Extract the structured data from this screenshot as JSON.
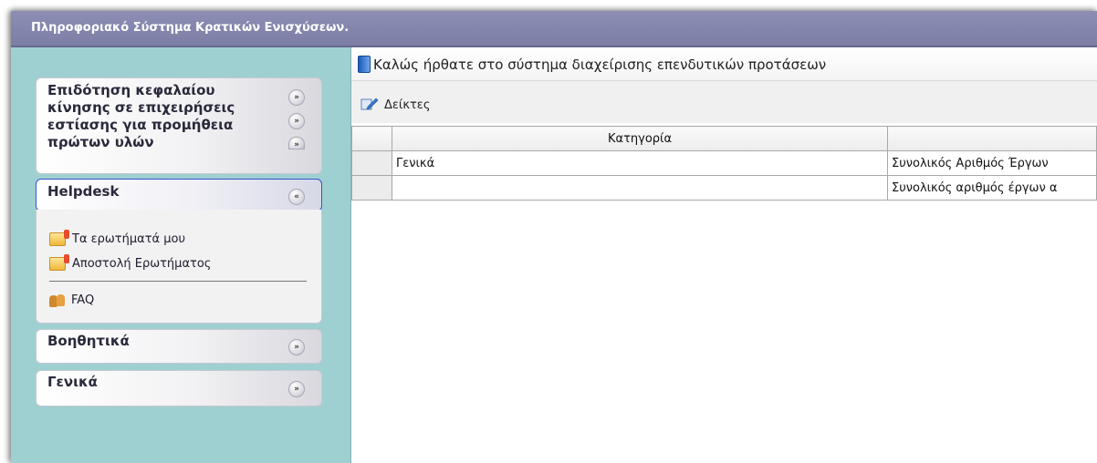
{
  "app": {
    "title": "Πληροφοριακό Σύστημα Κρατικών Ενισχύσεων."
  },
  "sidebar": {
    "panels": [
      {
        "title_lines": [
          "Επιδότηση κεφαλαίου",
          "κίνησης σε επιχειρήσεις",
          "εστίασης για προμήθεια",
          "πρώτων υλών"
        ],
        "expanded": false
      },
      {
        "title": "Helpdesk",
        "expanded": true,
        "links": [
          {
            "label": "Τα ερωτήματά μου",
            "icon": "folder-alert-icon"
          },
          {
            "label": "Αποστολή Ερωτήματος",
            "icon": "folder-alert-icon"
          },
          {
            "label": "FAQ",
            "icon": "users-icon"
          }
        ]
      },
      {
        "title": "Βοηθητικά",
        "expanded": false
      },
      {
        "title": "Γενικά",
        "expanded": false
      }
    ]
  },
  "main": {
    "welcome": "Καλώς ήρθατε στο σύστημα διαχείρισης επενδυτικών προτάσεων",
    "toolbar_label": "Δείκτες",
    "table": {
      "headers": [
        "",
        "Κατηγορία",
        ""
      ],
      "rows": [
        [
          "",
          "Γενικά",
          "Συνολικός Αριθμός Έργων"
        ],
        [
          "",
          "",
          "Συνολικός αριθμός έργων α"
        ]
      ]
    }
  },
  "colors": {
    "topbar": "#8c8eb4",
    "sidebar_bg": "#9fd0d1",
    "active_border": "#3355cc"
  }
}
